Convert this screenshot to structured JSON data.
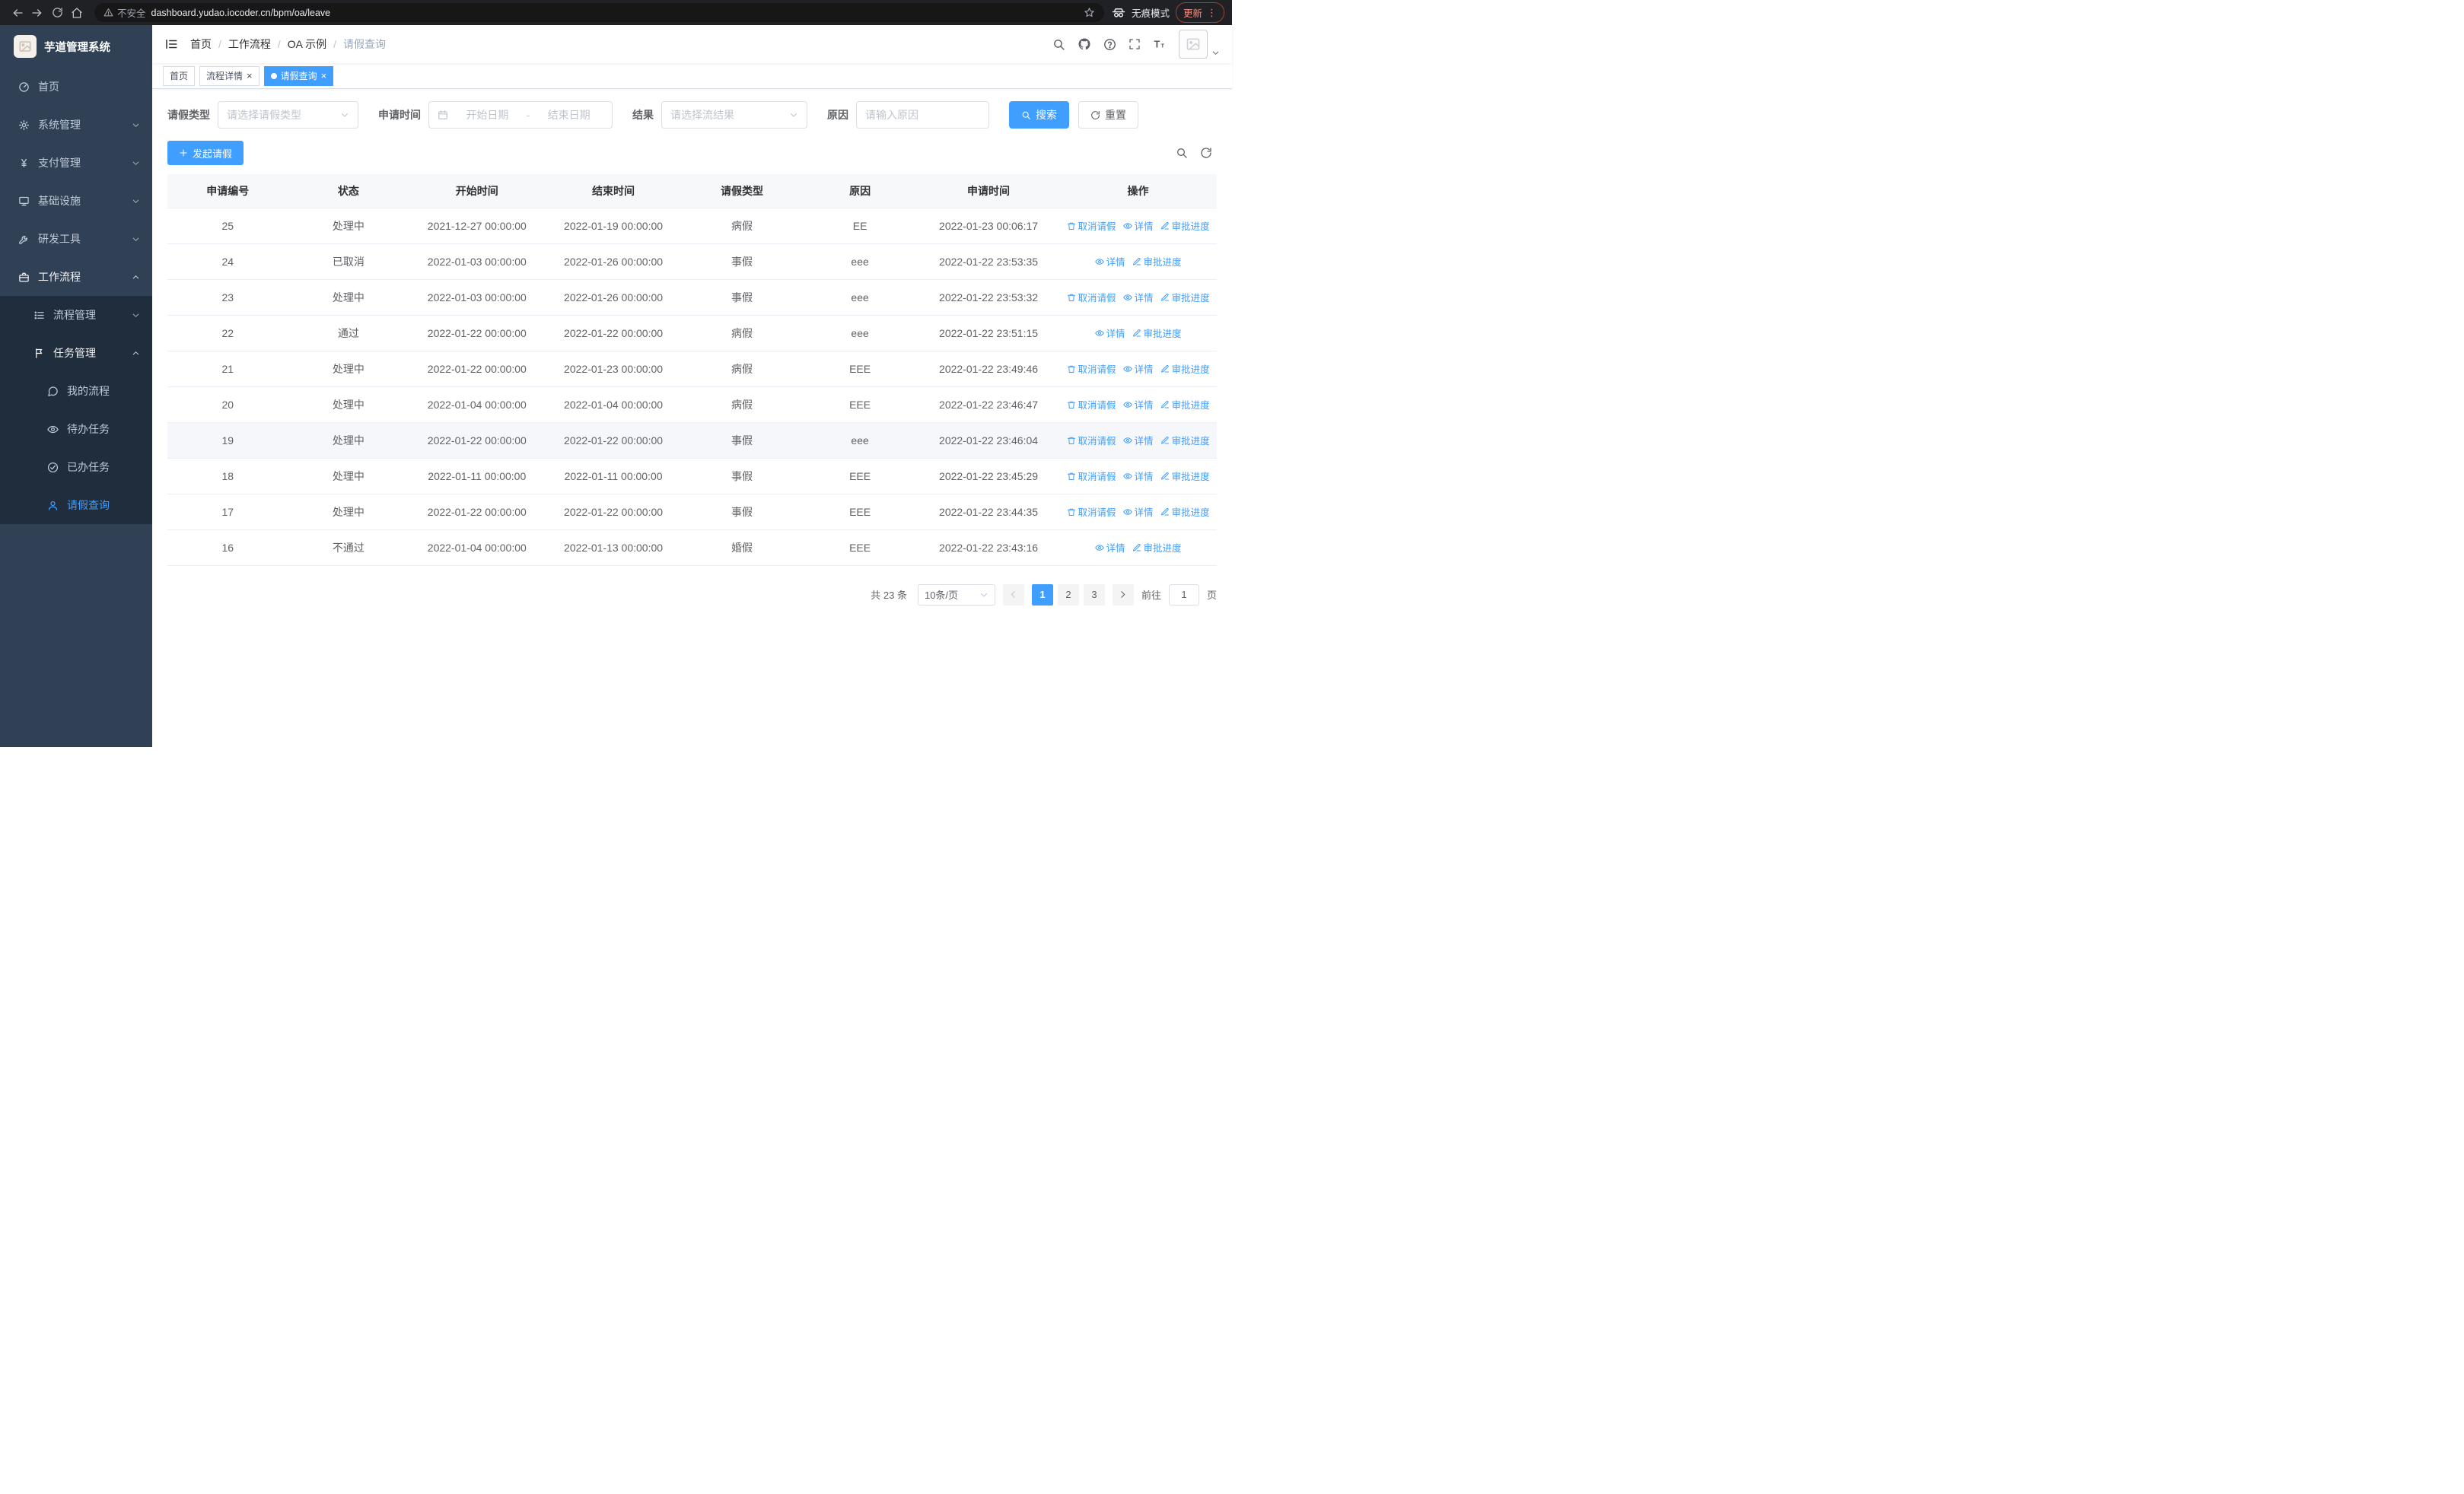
{
  "colors": {
    "accent": "#409eff",
    "sidebar_bg": "#304156",
    "sidebar_submenu_bg": "#1f2d3d",
    "active_menu_text": "#409eff",
    "update_pill_red": "#f28b82",
    "table_border": "#ebeef5"
  },
  "browser": {
    "security_label": "不安全",
    "url": "dashboard.yudao.iocoder.cn/bpm/oa/leave",
    "incognito_label": "无痕模式",
    "update_label": "更新"
  },
  "sidebar": {
    "logo_title": "芋道管理系统",
    "items": [
      {
        "label": "首页",
        "icon": "dashboard",
        "level": 1,
        "chevron": "",
        "sub": false,
        "active": false,
        "expanded": false
      },
      {
        "label": "系统管理",
        "icon": "gear",
        "level": 1,
        "chevron": "down",
        "sub": false,
        "active": false,
        "expanded": false
      },
      {
        "label": "支付管理",
        "icon": "yen",
        "level": 1,
        "chevron": "down",
        "sub": false,
        "active": false,
        "expanded": false
      },
      {
        "label": "基础设施",
        "icon": "monitor",
        "level": 1,
        "chevron": "down",
        "sub": false,
        "active": false,
        "expanded": false
      },
      {
        "label": "研发工具",
        "icon": "tool",
        "level": 1,
        "chevron": "down",
        "sub": false,
        "active": false,
        "expanded": false
      },
      {
        "label": "工作流程",
        "icon": "briefcase",
        "level": 1,
        "chevron": "up",
        "sub": false,
        "active": false,
        "expanded": true
      },
      {
        "label": "流程管理",
        "icon": "list",
        "level": 2,
        "chevron": "down",
        "sub": true,
        "active": false,
        "expanded": false
      },
      {
        "label": "任务管理",
        "icon": "flag",
        "level": 2,
        "chevron": "up",
        "sub": true,
        "active": false,
        "expanded": true
      },
      {
        "label": "我的流程",
        "icon": "chat",
        "level": 3,
        "chevron": "",
        "sub": true,
        "active": false,
        "expanded": false
      },
      {
        "label": "待办任务",
        "icon": "eye",
        "level": 3,
        "chevron": "",
        "sub": true,
        "active": false,
        "expanded": false
      },
      {
        "label": "已办任务",
        "icon": "check-circle",
        "level": 3,
        "chevron": "",
        "sub": true,
        "active": false,
        "expanded": false
      },
      {
        "label": "请假查询",
        "icon": "user",
        "level": 3,
        "chevron": "",
        "sub": true,
        "active": true,
        "expanded": false
      }
    ]
  },
  "breadcrumb": {
    "separator": "/",
    "items": [
      "首页",
      "工作流程",
      "OA 示例",
      "请假查询"
    ]
  },
  "tabs": [
    {
      "label": "首页",
      "closable": false,
      "active": false
    },
    {
      "label": "流程详情",
      "closable": true,
      "active": false
    },
    {
      "label": "请假查询",
      "closable": true,
      "active": true
    }
  ],
  "filters": {
    "leave_type_label": "请假类型",
    "leave_type_placeholder": "请选择请假类型",
    "apply_time_label": "申请时间",
    "start_date_placeholder": "开始日期",
    "range_separator": "-",
    "end_date_placeholder": "结束日期",
    "result_label": "结果",
    "result_placeholder": "请选择流结果",
    "reason_label": "原因",
    "reason_placeholder": "请输入原因",
    "search_button": "搜索",
    "reset_button": "重置"
  },
  "toolbar": {
    "create_button": "发起请假"
  },
  "table": {
    "columns": [
      "申请编号",
      "状态",
      "开始时间",
      "结束时间",
      "请假类型",
      "原因",
      "申请时间",
      "操作"
    ],
    "op_labels": {
      "cancel": "取消请假",
      "detail": "详情",
      "progress": "审批进度"
    },
    "rows": [
      {
        "id": "25",
        "status": "处理中",
        "start": "2021-12-27 00:00:00",
        "end": "2022-01-19 00:00:00",
        "type": "病假",
        "reason": "EE",
        "apply_time": "2022-01-23 00:06:17",
        "ops": [
          "cancel",
          "detail",
          "progress"
        ],
        "highlight": false
      },
      {
        "id": "24",
        "status": "已取消",
        "start": "2022-01-03 00:00:00",
        "end": "2022-01-26 00:00:00",
        "type": "事假",
        "reason": "eee",
        "apply_time": "2022-01-22 23:53:35",
        "ops": [
          "detail",
          "progress"
        ],
        "highlight": false
      },
      {
        "id": "23",
        "status": "处理中",
        "start": "2022-01-03 00:00:00",
        "end": "2022-01-26 00:00:00",
        "type": "事假",
        "reason": "eee",
        "apply_time": "2022-01-22 23:53:32",
        "ops": [
          "cancel",
          "detail",
          "progress"
        ],
        "highlight": false
      },
      {
        "id": "22",
        "status": "通过",
        "start": "2022-01-22 00:00:00",
        "end": "2022-01-22 00:00:00",
        "type": "病假",
        "reason": "eee",
        "apply_time": "2022-01-22 23:51:15",
        "ops": [
          "detail",
          "progress"
        ],
        "highlight": false
      },
      {
        "id": "21",
        "status": "处理中",
        "start": "2022-01-22 00:00:00",
        "end": "2022-01-23 00:00:00",
        "type": "病假",
        "reason": "EEE",
        "apply_time": "2022-01-22 23:49:46",
        "ops": [
          "cancel",
          "detail",
          "progress"
        ],
        "highlight": false
      },
      {
        "id": "20",
        "status": "处理中",
        "start": "2022-01-04 00:00:00",
        "end": "2022-01-04 00:00:00",
        "type": "病假",
        "reason": "EEE",
        "apply_time": "2022-01-22 23:46:47",
        "ops": [
          "cancel",
          "detail",
          "progress"
        ],
        "highlight": false
      },
      {
        "id": "19",
        "status": "处理中",
        "start": "2022-01-22 00:00:00",
        "end": "2022-01-22 00:00:00",
        "type": "事假",
        "reason": "eee",
        "apply_time": "2022-01-22 23:46:04",
        "ops": [
          "cancel",
          "detail",
          "progress"
        ],
        "highlight": true
      },
      {
        "id": "18",
        "status": "处理中",
        "start": "2022-01-11 00:00:00",
        "end": "2022-01-11 00:00:00",
        "type": "事假",
        "reason": "EEE",
        "apply_time": "2022-01-22 23:45:29",
        "ops": [
          "cancel",
          "detail",
          "progress"
        ],
        "highlight": false
      },
      {
        "id": "17",
        "status": "处理中",
        "start": "2022-01-22 00:00:00",
        "end": "2022-01-22 00:00:00",
        "type": "事假",
        "reason": "EEE",
        "apply_time": "2022-01-22 23:44:35",
        "ops": [
          "cancel",
          "detail",
          "progress"
        ],
        "highlight": false
      },
      {
        "id": "16",
        "status": "不通过",
        "start": "2022-01-04 00:00:00",
        "end": "2022-01-13 00:00:00",
        "type": "婚假",
        "reason": "EEE",
        "apply_time": "2022-01-22 23:43:16",
        "ops": [
          "detail",
          "progress"
        ],
        "highlight": false
      }
    ]
  },
  "pagination": {
    "total_text": "共 23 条",
    "page_size": "10条/页",
    "pages": [
      "1",
      "2",
      "3"
    ],
    "active_page": "1",
    "goto_label": "前往",
    "goto_value": "1",
    "page_label": "页"
  }
}
